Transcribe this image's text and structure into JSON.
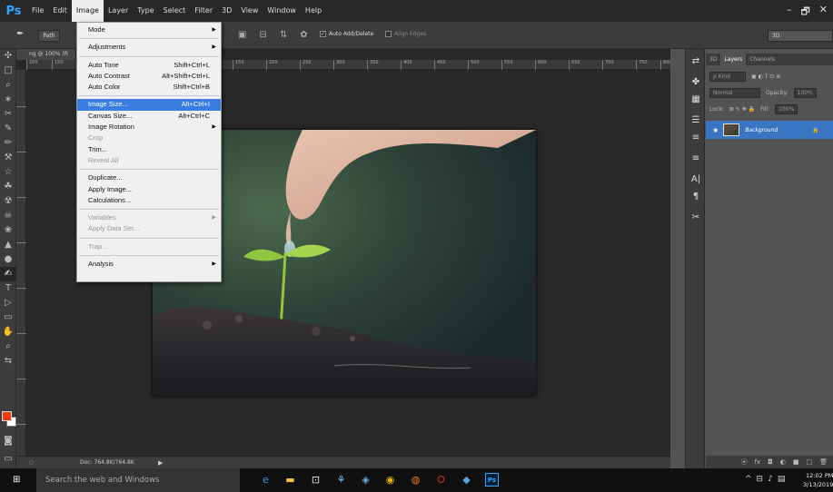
{
  "app": {
    "logo": "Ps",
    "menu": [
      "File",
      "Edit",
      "Image",
      "Layer",
      "Type",
      "Select",
      "Filter",
      "3D",
      "View",
      "Window",
      "Help"
    ],
    "active_menu": "Image",
    "window_controls": [
      "–",
      "🗗",
      "✕"
    ]
  },
  "options_bar": {
    "path_label": "Path",
    "auto_add_delete": "Auto Add/Delete",
    "align_edges": "Align Edges",
    "workspace": "3D"
  },
  "document": {
    "tab_title": "ng @ 100% (R",
    "ruler_h": [
      "200",
      "150",
      "150",
      "200",
      "250",
      "300",
      "350",
      "400",
      "450",
      "500",
      "550",
      "600",
      "650",
      "700",
      "750",
      "800"
    ],
    "status": {
      "zoom": "○",
      "doc": "Doc: 764.8K/764.8K",
      "arrow": "▶"
    }
  },
  "image_menu": {
    "sections": [
      [
        {
          "label": "Mode",
          "submenu": true
        }
      ],
      [
        {
          "label": "Adjustments",
          "submenu": true
        }
      ],
      [
        {
          "label": "Auto Tone",
          "shortcut": "Shift+Ctrl+L"
        },
        {
          "label": "Auto Contrast",
          "shortcut": "Alt+Shift+Ctrl+L"
        },
        {
          "label": "Auto Color",
          "shortcut": "Shift+Ctrl+B"
        }
      ],
      [
        {
          "label": "Image Size...",
          "shortcut": "Alt+Ctrl+I",
          "highlighted": true
        },
        {
          "label": "Canvas Size...",
          "shortcut": "Alt+Ctrl+C"
        },
        {
          "label": "Image Rotation",
          "submenu": true
        },
        {
          "label": "Crop",
          "disabled": true
        },
        {
          "label": "Trim..."
        },
        {
          "label": "Reveal All",
          "disabled": true
        }
      ],
      [
        {
          "label": "Duplicate..."
        },
        {
          "label": "Apply Image..."
        },
        {
          "label": "Calculations..."
        }
      ],
      [
        {
          "label": "Variables",
          "submenu": true,
          "disabled": true
        },
        {
          "label": "Apply Data Set...",
          "disabled": true
        }
      ],
      [
        {
          "label": "Trap...",
          "disabled": true
        }
      ],
      [
        {
          "label": "Analysis",
          "submenu": true
        }
      ]
    ]
  },
  "panels": {
    "tabs": [
      "3D",
      "Layers",
      "Channels"
    ],
    "active_tab": "Layers",
    "kind_label": "ρ Kind",
    "blend_mode": "Normal",
    "opacity_label": "Opacity:",
    "opacity_value": "100%",
    "lock_label": "Lock:",
    "fill_label": "Fill:",
    "fill_value": "100%",
    "layer_name": "Background",
    "footer_icons": [
      "⦿",
      "fx",
      "◘",
      "◐",
      "■",
      "□",
      "🗑"
    ]
  },
  "icon_strip": [
    "⇄",
    "✤",
    "▦",
    "☰",
    "≡",
    "≡",
    "A|",
    "¶",
    "✂"
  ],
  "tools": [
    "✣",
    "□",
    "⌕",
    "∗",
    "✂",
    "✎",
    "✏",
    "⚒",
    "☆",
    "☘",
    "☢",
    "☠",
    "❀",
    "▲",
    "●",
    "✍",
    "T",
    "▷",
    "▭",
    "✋",
    "⌕",
    "⇆"
  ],
  "colors": {
    "foreground": "#f03c0a",
    "background": "#ffffff",
    "accent": "#3b7de0",
    "ps_blue": "#31a8ff"
  },
  "taskbar": {
    "search_placeholder": "Search the web and Windows",
    "time": "12:02 PM",
    "date": "3/13/2019",
    "apps": [
      "edge",
      "file-explorer",
      "store",
      "network",
      "tools",
      "chrome",
      "firefox",
      "opera",
      "media",
      "photoshop"
    ]
  }
}
